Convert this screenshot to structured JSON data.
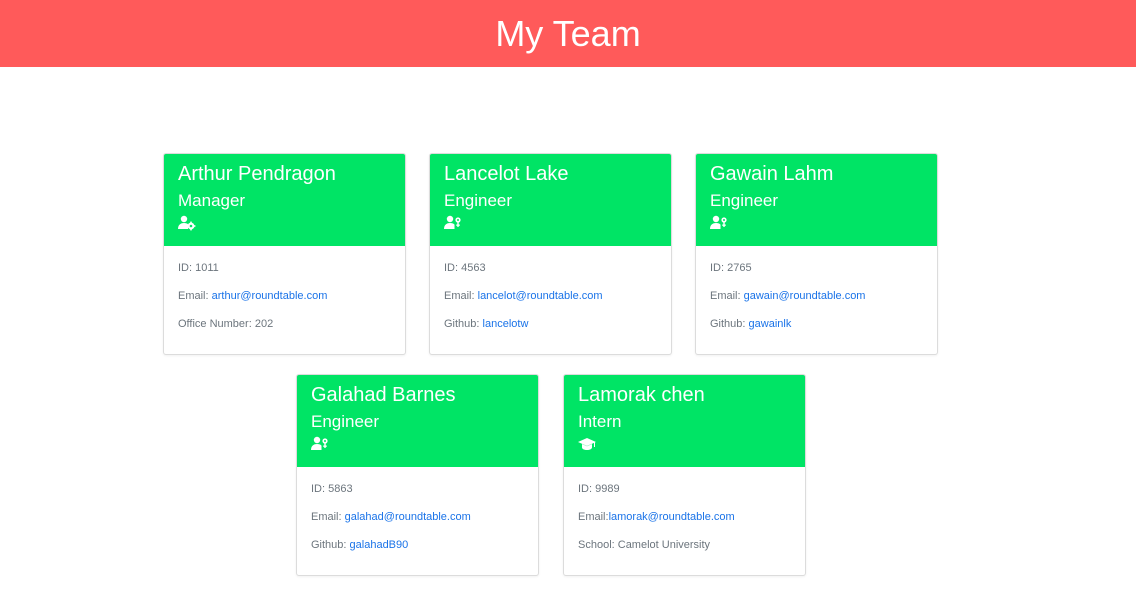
{
  "header": {
    "title": "My Team",
    "background_color": "#ff5a5a"
  },
  "colors": {
    "card_header": "#00e465",
    "link": "#1a73e8",
    "body_text": "#6c757d"
  },
  "cards": [
    {
      "name": "Arthur Pendragon",
      "role": "Manager",
      "icon": "user-cog-icon",
      "id_label": "ID: ",
      "id": "1011",
      "email_label": "Email: ",
      "email": "arthur@roundtable.com",
      "extra_label": "Office Number: ",
      "extra_value": "202"
    },
    {
      "name": "Lancelot Lake",
      "role": "Engineer",
      "icon": "user-gear-icon",
      "id_label": "ID: ",
      "id": "4563",
      "email_label": "Email: ",
      "email": "lancelot@roundtable.com",
      "extra_label": "Github: ",
      "extra_value": "lancelotw"
    },
    {
      "name": "Gawain Lahm",
      "role": "Engineer",
      "icon": "user-gear-icon",
      "id_label": "ID: ",
      "id": "2765",
      "email_label": "Email: ",
      "email": "gawain@roundtable.com",
      "extra_label": "Github: ",
      "extra_value": "gawainlk"
    },
    {
      "name": "Galahad Barnes",
      "role": "Engineer",
      "icon": "user-gear-icon",
      "id_label": "ID: ",
      "id": "5863",
      "email_label": "Email: ",
      "email": "galahad@roundtable.com",
      "extra_label": "Github: ",
      "extra_value": "galahadB90"
    },
    {
      "name": "Lamorak chen",
      "role": "Intern",
      "icon": "graduation-cap-icon",
      "id_label": "ID: ",
      "id": "9989",
      "email_label": "Email:",
      "email": "lamorak@roundtable.com",
      "extra_label": "School: ",
      "extra_value": "Camelot University"
    }
  ]
}
